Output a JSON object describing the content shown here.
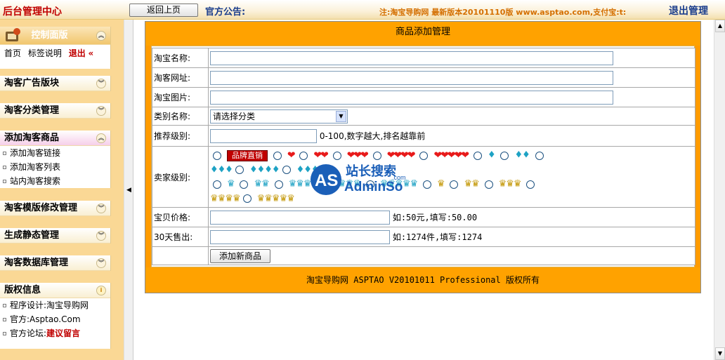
{
  "topbar": {
    "brand": "后台管理中心",
    "back_button": "返回上页",
    "notice_label": "官方公告:",
    "notice_text": "注:淘宝导购网 最新版本20101110版 www.asptao.com,支付宝:t:",
    "logout": "退出管理"
  },
  "sidebar": {
    "panels": [
      {
        "title": "控制面版",
        "links": [
          "首页",
          "标签说明",
          "退出"
        ]
      },
      {
        "title": "淘客广告版块"
      },
      {
        "title": "淘客分类管理"
      },
      {
        "title": "添加淘客商品",
        "items": [
          "添加淘客链接",
          "添加淘客列表",
          "站内淘客搜索"
        ]
      },
      {
        "title": "淘客模版修改管理"
      },
      {
        "title": "生成静态管理"
      },
      {
        "title": "淘客数据库管理"
      },
      {
        "title": "版权信息",
        "items": [
          "程序设计:淘宝导购网",
          "官方:Asptao.Com",
          "官方论坛:"
        ],
        "highlight": "建议留言"
      }
    ]
  },
  "form": {
    "title": "商品添加管理",
    "rows": {
      "name": "淘宝名称:",
      "url": "淘客网址:",
      "image": "淘宝图片:",
      "category": "类别名称:",
      "category_value": "请选择分类",
      "rank": "推荐级别:",
      "rank_hint": "0-100,数字越大,排名越靠前",
      "seller": "卖家级别:",
      "brand_tag": "品牌直销",
      "price": "宝贝价格:",
      "price_hint": "如:50元,填写:50.00",
      "sales": "30天售出:",
      "sales_hint": "如:1274件,填写:1274"
    },
    "submit": "添加新商品",
    "footer": "淘宝导购网 ASPTAO V20101011 Professional 版权所有"
  },
  "watermark": {
    "line1": "站长搜索",
    "line2": "AdminSo",
    "brand": "AS",
    "url": ".com"
  },
  "colors": {
    "accent": "#ffa200",
    "sidebar_bg": "#fad895",
    "brand_red": "#c00000",
    "heart": "#e81a1a",
    "diamond": "#1ea2c4",
    "crown": "#c29500"
  }
}
